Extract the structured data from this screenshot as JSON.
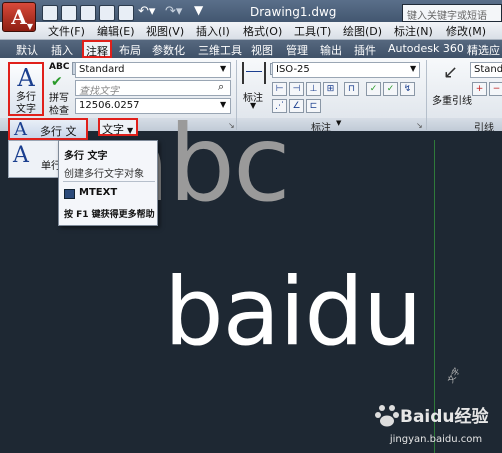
{
  "titlebar": {
    "app_letter": "A",
    "doc_title": "Drawing1.dwg",
    "search_placeholder": "键入关键字或短语"
  },
  "menubar": {
    "items": [
      "文件(F)",
      "编辑(E)",
      "视图(V)",
      "插入(I)",
      "格式(O)",
      "工具(T)",
      "绘图(D)",
      "标注(N)",
      "修改(M)"
    ]
  },
  "tabs": {
    "items": [
      "默认",
      "插入",
      "注释",
      "布局",
      "参数化",
      "三维工具",
      "视图",
      "管理",
      "输出",
      "插件",
      "Autodesk 360",
      "精选应用"
    ],
    "active": "注释"
  },
  "ribbon": {
    "text_panel": {
      "mtext_big_glyph": "A",
      "mtext_big_label": "多行\n文字",
      "abc_label": "ABC",
      "spell_label": "拼写",
      "check_label": "检查",
      "style_value": "Standard",
      "find_placeholder": "查找文字",
      "height_value": "12506.0257",
      "panel_title": "文字"
    },
    "dim_panel": {
      "dim_label": "标注",
      "dim_style_value": "ISO-25",
      "panel_title": "标注"
    },
    "leader_panel": {
      "multileader_label": "多重引线",
      "leader_style_value": "Standa",
      "panel_title": "引线"
    }
  },
  "dropdown": {
    "mtext_label": "多行 文字",
    "text_dd_label": "文字",
    "single_line_label": "单行"
  },
  "tooltip": {
    "title": "多行 文字",
    "description": "创建多行文字对象",
    "command": "MTEXT",
    "help": "按 F1 键获得更多帮助"
  },
  "canvas": {
    "text1": "abc",
    "text2": "baidu",
    "watermark_brand": "Baidu经验",
    "watermark_url": "jingyan.baidu.com"
  },
  "colors": {
    "highlight_red": "#e0201b",
    "canvas_bg": "#1e2833",
    "abc_gray": "#9a9a9a"
  }
}
